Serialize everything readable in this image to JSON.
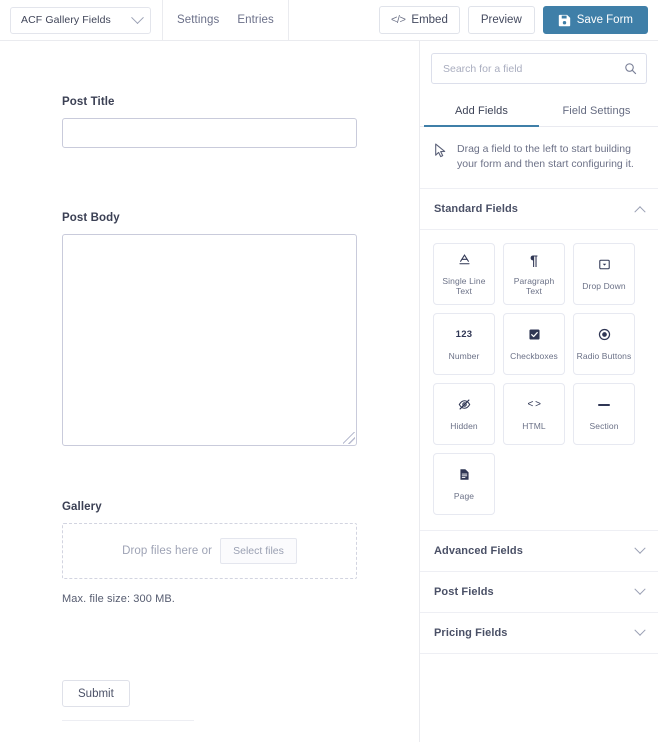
{
  "toolbar": {
    "form_selector_label": "ACF Gallery Fields",
    "chevron_icon": "chevron-down-icon",
    "nav": [
      {
        "label": "Settings",
        "name": "nav-settings"
      },
      {
        "label": "Entries",
        "name": "nav-entries"
      }
    ],
    "embed_label": "Embed",
    "embed_icon": "code-icon",
    "preview_label": "Preview",
    "save_label": "Save Form",
    "save_icon": "floppy-disk-icon",
    "save_button_color": "#3f7fa8"
  },
  "form_preview": {
    "fields": [
      {
        "label": "Post Title",
        "type": "text"
      },
      {
        "label": "Post Body",
        "type": "textarea"
      },
      {
        "label": "Gallery",
        "type": "fileupload"
      }
    ],
    "dropzone": {
      "drop_text": "Drop files here or",
      "select_button": "Select files",
      "max_size_note": "Max. file size: 300 MB."
    },
    "submit_label": "Submit"
  },
  "panel": {
    "search": {
      "placeholder": "Search for a field",
      "value": "",
      "icon": "search-icon"
    },
    "tabs": [
      {
        "label": "Add Fields",
        "active": true
      },
      {
        "label": "Field Settings",
        "active": false
      }
    ],
    "active_tab_color": "#3f7fa8",
    "hint": {
      "icon": "cursor-arrow-icon",
      "text": "Drag a field to the left to start building your form and then start configuring it."
    },
    "sections": [
      {
        "title": "Standard Fields",
        "expanded": true
      },
      {
        "title": "Advanced Fields",
        "expanded": false
      },
      {
        "title": "Post Fields",
        "expanded": false
      },
      {
        "title": "Pricing Fields",
        "expanded": false
      }
    ],
    "standard_fields": [
      {
        "label": "Single Line Text",
        "icon": "underlined-a-icon"
      },
      {
        "label": "Paragraph Text",
        "icon": "pilcrow-icon"
      },
      {
        "label": "Drop Down",
        "icon": "dropdown-box-icon"
      },
      {
        "label": "Number",
        "icon": "123-icon"
      },
      {
        "label": "Checkboxes",
        "icon": "checkbox-checked-icon"
      },
      {
        "label": "Radio Buttons",
        "icon": "radio-selected-icon"
      },
      {
        "label": "Hidden",
        "icon": "eye-slash-icon"
      },
      {
        "label": "HTML",
        "icon": "angle-brackets-icon"
      },
      {
        "label": "Section",
        "icon": "horizontal-line-icon"
      },
      {
        "label": "Page",
        "icon": "document-page-icon"
      }
    ]
  }
}
